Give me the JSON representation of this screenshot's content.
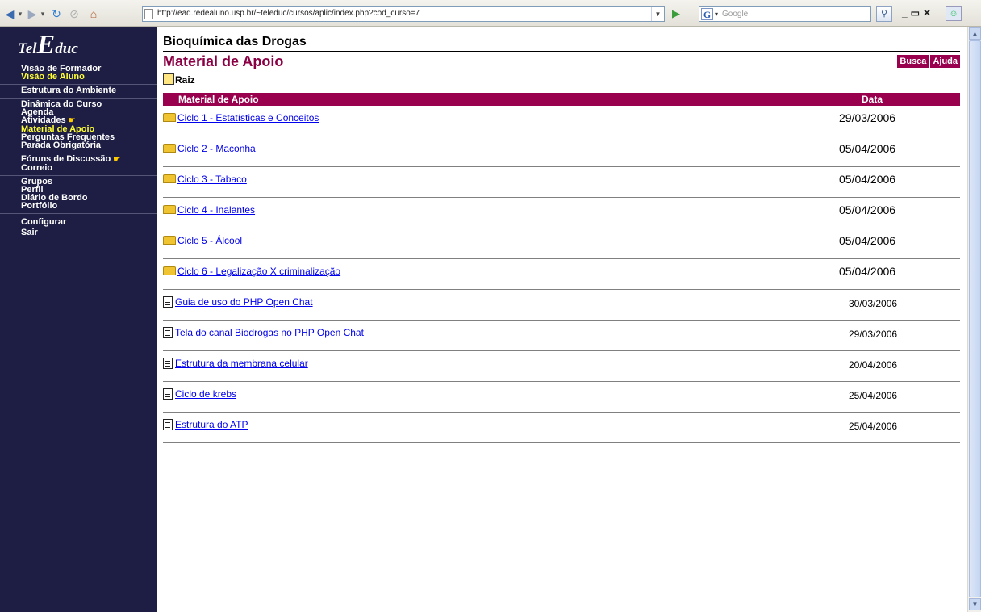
{
  "browser": {
    "url": "http://ead.redealuno.usp.br/~teleduc/cursos/aplic/index.php?cod_curso=7",
    "search_placeholder": "Google",
    "search_logo": "G"
  },
  "sidebar": {
    "logo_part1": "Tel",
    "logo_part2": "E",
    "logo_part3": "duc",
    "groups": [
      [
        "Visão de Formador",
        "Visão de Aluno"
      ],
      [
        "Estrutura do Ambiente"
      ],
      [
        "Dinâmica do Curso",
        "Agenda",
        "Atividades",
        "Material de Apoio",
        "Perguntas Frequentes",
        "Parada Obrigatória"
      ],
      [
        "Fóruns de Discussão",
        "Correio"
      ],
      [
        "Grupos",
        "Perfil",
        "Diário de Bordo",
        "Portfólio"
      ],
      [
        "Configurar",
        "Sair"
      ]
    ],
    "colors": {
      "background": "#1e1e45",
      "highlight": "#ffff33"
    }
  },
  "main": {
    "course_title": "Bioquímica das Drogas",
    "page_title": "Material de Apoio",
    "search_link": "Busca",
    "help_link": "Ajuda",
    "root_label": "Raiz",
    "table": {
      "headers": [
        "Material de Apoio",
        "Data"
      ],
      "rows": [
        {
          "type": "folder",
          "name": "Ciclo 1 - Estatísticas e Conceitos",
          "date": "29/03/2006"
        },
        {
          "type": "folder",
          "name": "Ciclo 2 - Maconha",
          "date": "05/04/2006"
        },
        {
          "type": "folder",
          "name": "Ciclo 3 - Tabaco",
          "date": "05/04/2006"
        },
        {
          "type": "folder",
          "name": "Ciclo 4 - Inalantes",
          "date": "05/04/2006"
        },
        {
          "type": "folder",
          "name": "Ciclo 5 - Álcool",
          "date": "05/04/2006"
        },
        {
          "type": "folder",
          "name": "Ciclo 6 - Legalização X criminalização",
          "date": "05/04/2006"
        },
        {
          "type": "file",
          "name": "Guia de uso do PHP Open Chat",
          "date": "30/03/2006"
        },
        {
          "type": "file",
          "name": "Tela do canal Biodrogas no PHP Open Chat",
          "date": "29/03/2006"
        },
        {
          "type": "file",
          "name": "Estrutura da membrana celular",
          "date": "20/04/2006"
        },
        {
          "type": "file",
          "name": "Ciclo de krebs",
          "date": "25/04/2006"
        },
        {
          "type": "file",
          "name": "Estrutura do ATP",
          "date": "25/04/2006"
        }
      ]
    },
    "colors": {
      "accent": "#99004d",
      "title": "#8b0044",
      "link": "#0000ee"
    }
  }
}
